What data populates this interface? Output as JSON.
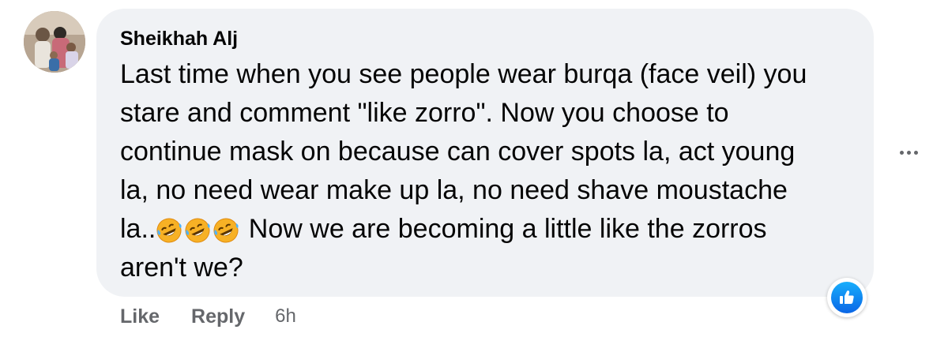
{
  "comment": {
    "author": "Sheikhah Alj",
    "text_lines": [
      "Last time when you see people wear burqa (face veil) you",
      "stare and comment \"like zorro\". Now you choose to",
      "continue mask on because can cover spots la, act young",
      "la, no need wear make up la, no need shave moustache",
      "la..",
      " Now we are becoming a little like the zorros",
      "aren't we?"
    ],
    "emojis": [
      "rolling-on-floor-laughing",
      "rolling-on-floor-laughing",
      "rolling-on-floor-laughing"
    ]
  },
  "actions": {
    "like_label": "Like",
    "reply_label": "Reply",
    "timestamp": "6h"
  },
  "reaction": {
    "icon": "thumbs-up-icon",
    "color": "#1877f2"
  },
  "colors": {
    "bubble": "#f0f2f5",
    "text": "#050505",
    "secondary": "#65676b"
  }
}
